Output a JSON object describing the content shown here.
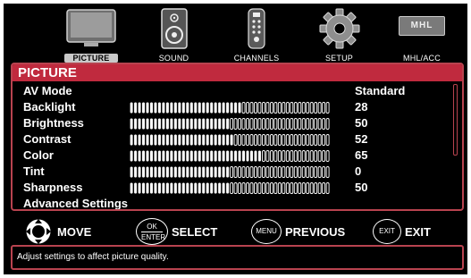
{
  "tabs": [
    {
      "label": "PICTURE",
      "icon": "tv-icon",
      "active": true
    },
    {
      "label": "SOUND",
      "icon": "speaker-icon",
      "active": false
    },
    {
      "label": "CHANNELS",
      "icon": "remote-icon",
      "active": false
    },
    {
      "label": "SETUP",
      "icon": "gear-icon",
      "active": false
    },
    {
      "label": "MHL/ACC",
      "icon": "mhl-icon",
      "active": false
    }
  ],
  "mhl_logo_text": "MHL",
  "panel": {
    "title": "PICTURE",
    "rows": [
      {
        "name": "AV Mode",
        "value": "Standard"
      },
      {
        "name": "Backlight",
        "value": "28",
        "level": 0.56
      },
      {
        "name": "Brightness",
        "value": "50",
        "level": 0.5
      },
      {
        "name": "Contrast",
        "value": "52",
        "level": 0.52
      },
      {
        "name": "Color",
        "value": "65",
        "level": 0.65
      },
      {
        "name": "Tint",
        "value": "0",
        "level": 0.5
      },
      {
        "name": "Sharpness",
        "value": "50",
        "level": 0.5
      },
      {
        "name": "Advanced Settings",
        "value": ""
      }
    ]
  },
  "hints": {
    "move": "MOVE",
    "ok_top": "OK",
    "ok_bottom": "ENTER",
    "select": "SELECT",
    "menu_key": "MENU",
    "previous": "PREVIOUS",
    "exit_key": "EXIT",
    "exit": "EXIT"
  },
  "status_text": "Adjust settings to affect picture quality.",
  "colors": {
    "accent": "#c02a3e",
    "border": "#b8434f"
  }
}
